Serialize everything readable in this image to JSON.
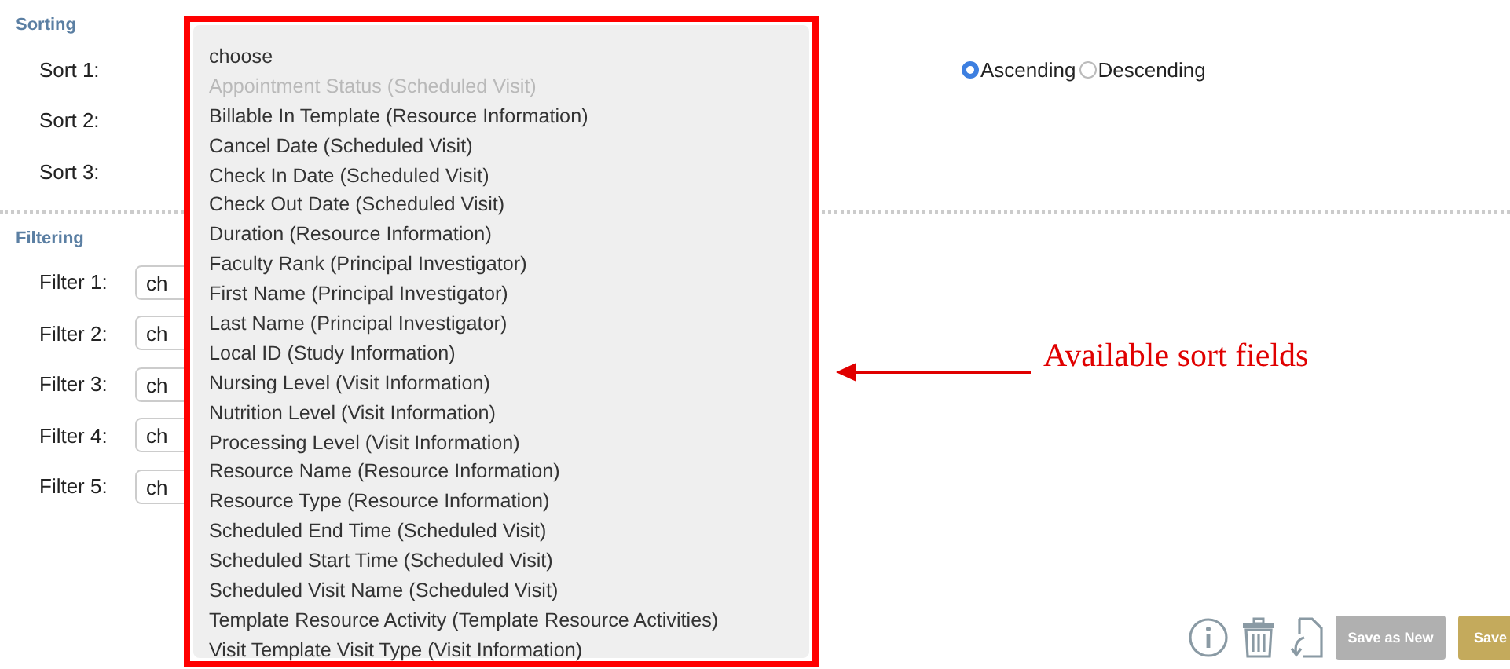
{
  "sorting": {
    "title": "Sorting",
    "rows": [
      {
        "label": "Sort 1:",
        "order": [
          {
            "label": "Ascending",
            "selected": true
          },
          {
            "label": "Descending",
            "selected": false
          }
        ]
      },
      {
        "label": "Sort 2:"
      },
      {
        "label": "Sort 3:"
      }
    ]
  },
  "filtering": {
    "title": "Filtering",
    "rows": [
      {
        "label": "Filter 1:",
        "value": "ch"
      },
      {
        "label": "Filter 2:",
        "value": "ch"
      },
      {
        "label": "Filter 3:",
        "value": "ch"
      },
      {
        "label": "Filter 4:",
        "value": "ch"
      },
      {
        "label": "Filter 5:",
        "value": "ch"
      }
    ]
  },
  "dropdown": {
    "options": [
      {
        "label": "choose",
        "disabled": false
      },
      {
        "label": "Appointment Status (Scheduled Visit)",
        "disabled": true
      },
      {
        "label": "Billable In Template (Resource Information)",
        "disabled": false
      },
      {
        "label": "Cancel Date (Scheduled Visit)",
        "disabled": false
      },
      {
        "label": "Check In Date (Scheduled Visit)",
        "disabled": false
      },
      {
        "label": "Check Out Date (Scheduled Visit)",
        "disabled": false
      },
      {
        "label": "Duration (Resource Information)",
        "disabled": false
      },
      {
        "label": "Faculty Rank (Principal Investigator)",
        "disabled": false
      },
      {
        "label": "First Name (Principal Investigator)",
        "disabled": false
      },
      {
        "label": "Last Name (Principal Investigator)",
        "disabled": false
      },
      {
        "label": "Local ID (Study Information)",
        "disabled": false
      },
      {
        "label": "Nursing Level (Visit Information)",
        "disabled": false
      },
      {
        "label": "Nutrition Level (Visit Information)",
        "disabled": false
      },
      {
        "label": "Processing Level (Visit Information)",
        "disabled": false
      },
      {
        "label": "Resource Name (Resource Information)",
        "disabled": false
      },
      {
        "label": "Resource Type (Resource Information)",
        "disabled": false
      },
      {
        "label": "Scheduled End Time (Scheduled Visit)",
        "disabled": false
      },
      {
        "label": "Scheduled Start Time (Scheduled Visit)",
        "disabled": false
      },
      {
        "label": "Scheduled Visit Name (Scheduled Visit)",
        "disabled": false
      },
      {
        "label": "Template Resource Activity (Template Resource Activities)",
        "disabled": false
      },
      {
        "label": "Visit Template Visit Type (Visit Information)",
        "disabled": false
      }
    ]
  },
  "annotation": "Available sort fields",
  "buttons": [
    {
      "label": "Save as New",
      "kind": "secondary"
    },
    {
      "label": "Save",
      "kind": "primary"
    }
  ]
}
